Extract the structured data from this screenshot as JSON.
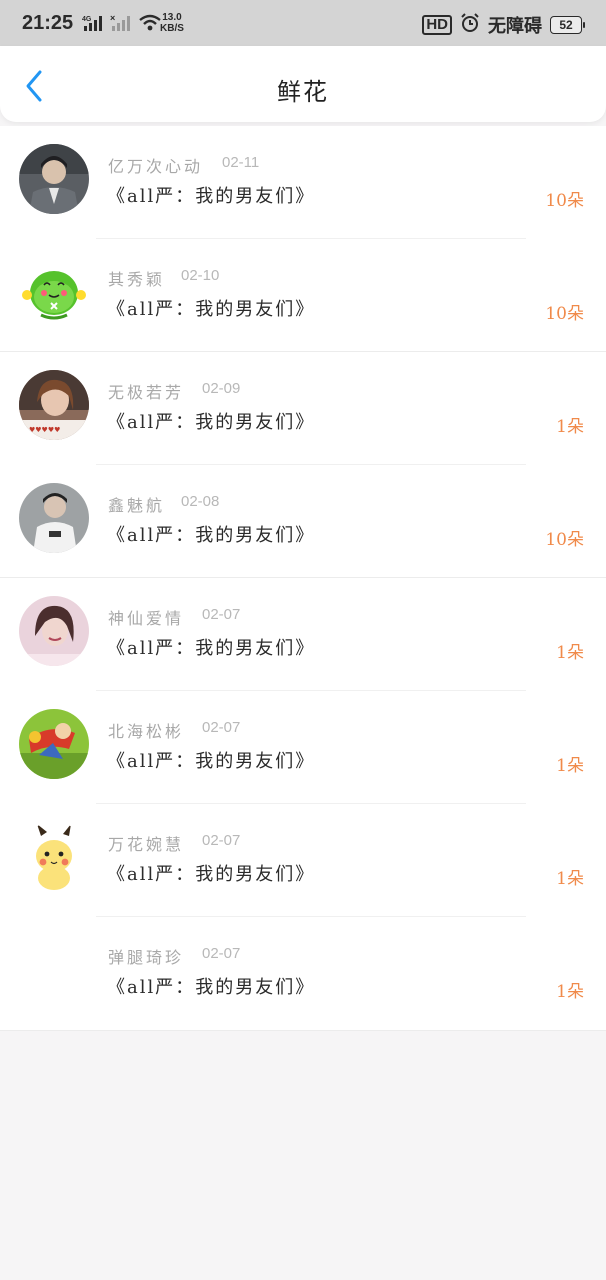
{
  "status_bar": {
    "time": "21:25",
    "net_speed_value": "13.0",
    "net_speed_unit": "KB/S",
    "net_type": "4G",
    "hd_label": "HD",
    "accessibility_label": "无障碍",
    "battery": "52"
  },
  "header": {
    "title": "鲜花",
    "back_icon": "chevron-left-icon"
  },
  "colors": {
    "accent_blue": "#2196f3",
    "amount_orange": "#f08a4a"
  },
  "list": [
    {
      "name": "亿万次心动",
      "date": "02-11",
      "book": "《all严：我的男友们》",
      "amount": "10朵",
      "avatar": "portrait-suit"
    },
    {
      "name": "其秀颖",
      "date": "02-10",
      "book": "《all严：我的男友们》",
      "amount": "10朵",
      "avatar": "green-cartoon"
    },
    {
      "name": "无极若芳",
      "date": "02-09",
      "book": "《all严：我的男友们》",
      "amount": "1朵",
      "avatar": "portrait-girl"
    },
    {
      "name": "鑫魅航",
      "date": "02-08",
      "book": "《all严：我的男友们》",
      "amount": "10朵",
      "avatar": "portrait-man"
    },
    {
      "name": "神仙爱情",
      "date": "02-07",
      "book": "《all严：我的男友们》",
      "amount": "1朵",
      "avatar": "portrait-pink"
    },
    {
      "name": "北海松彬",
      "date": "02-07",
      "book": "《all严：我的男友们》",
      "amount": "1朵",
      "avatar": "cartoon-action"
    },
    {
      "name": "万花婉慧",
      "date": "02-07",
      "book": "《all严：我的男友们》",
      "amount": "1朵",
      "avatar": "pikachu"
    },
    {
      "name": "弹腿琦珍",
      "date": "02-07",
      "book": "《all严：我的男友们》",
      "amount": "1朵",
      "avatar": "none"
    }
  ]
}
